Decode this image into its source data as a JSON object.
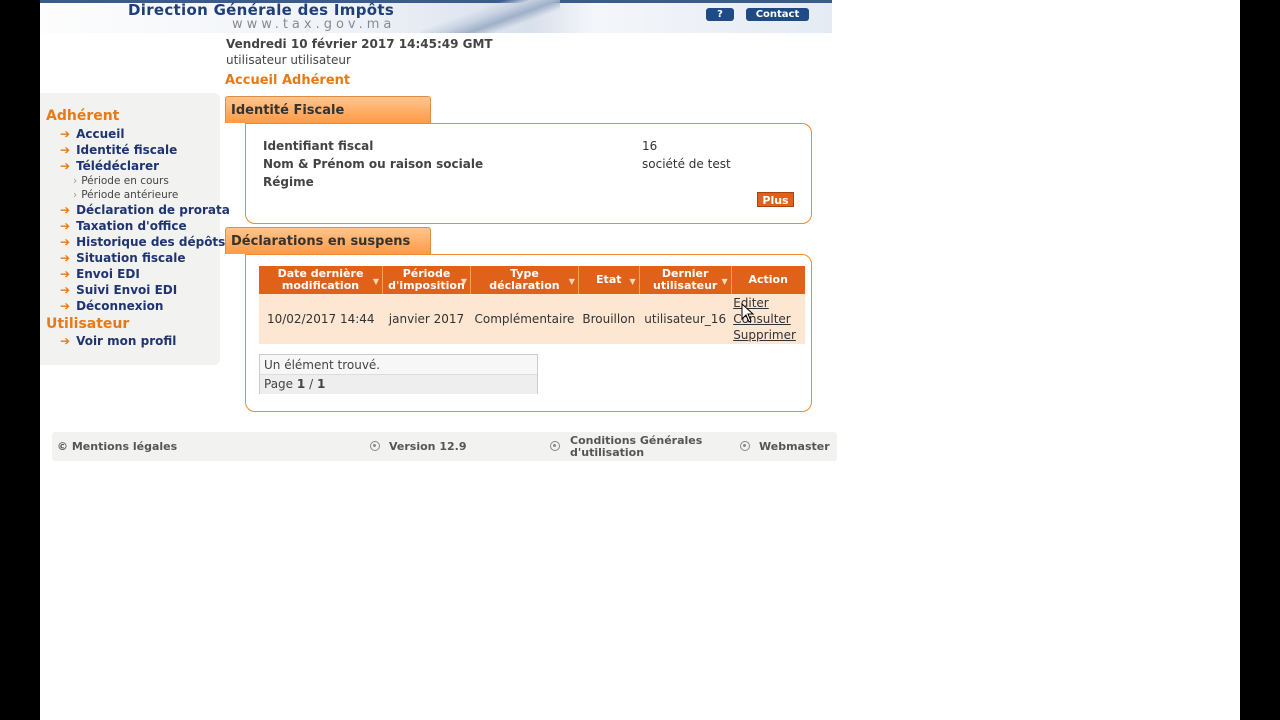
{
  "header": {
    "site_title": "Direction Générale des Impôts",
    "site_url": "www.tax.gov.ma",
    "help_label": "?",
    "contact_label": "Contact",
    "datetime": "Vendredi 10 février 2017 14:45:49 GMT",
    "user": "utilisateur utilisateur",
    "page_title": "Accueil Adhérent"
  },
  "sidebar": {
    "section_adherent": "Adhérent",
    "items": [
      {
        "label": "Accueil"
      },
      {
        "label": "Identité fiscale"
      },
      {
        "label": "Télédéclarer"
      },
      {
        "label": "Déclaration de prorata"
      },
      {
        "label": "Taxation d'office"
      },
      {
        "label": "Historique des dépôts"
      },
      {
        "label": "Situation fiscale"
      },
      {
        "label": "Envoi EDI"
      },
      {
        "label": "Suivi Envoi EDI"
      },
      {
        "label": "Déconnexion"
      }
    ],
    "subitems": [
      {
        "label": "Période en cours"
      },
      {
        "label": "Période antérieure"
      }
    ],
    "section_utilisateur": "Utilisateur",
    "user_items": [
      {
        "label": "Voir mon profil"
      }
    ]
  },
  "identite": {
    "tab_title": "Identité Fiscale",
    "fields": [
      {
        "label": "Identifiant fiscal",
        "value": "16"
      },
      {
        "label": "Nom & Prénom ou raison sociale",
        "value": "société de test"
      },
      {
        "label": "Régime",
        "value": ""
      }
    ],
    "plus_label": "Plus"
  },
  "suspens": {
    "tab_title": "Déclarations en suspens",
    "columns": [
      {
        "line1": "Date dernière",
        "line2": "modification"
      },
      {
        "line1": "Période",
        "line2": "d'imposition"
      },
      {
        "line1": "Type",
        "line2": "déclaration"
      },
      {
        "line1": "Etat",
        "line2": ""
      },
      {
        "line1": "Dernier",
        "line2": "utilisateur"
      },
      {
        "line1": "Action",
        "line2": ""
      }
    ],
    "row": {
      "date": "10/02/2017 14:44",
      "periode": "janvier  2017",
      "type": "Complémentaire",
      "etat": "Brouillon",
      "utilisateur": "utilisateur_16",
      "actions": [
        "Editer",
        "Consulter",
        "Supprimer"
      ]
    },
    "result_text": "Un élément trouvé.",
    "page_prefix": "Page",
    "page_current": "1",
    "page_sep": "/",
    "page_total": "1"
  },
  "footer": {
    "mentions": "© Mentions légales",
    "version": "Version 12.9",
    "conditions_line1": "Conditions Générales",
    "conditions_line2": "d'utilisation",
    "webmaster": "Webmaster"
  },
  "colors": {
    "accent": "#e57a16",
    "header_blue": "#1f3f78",
    "table_header": "#e0621a",
    "row_bg": "#fde6d2"
  }
}
